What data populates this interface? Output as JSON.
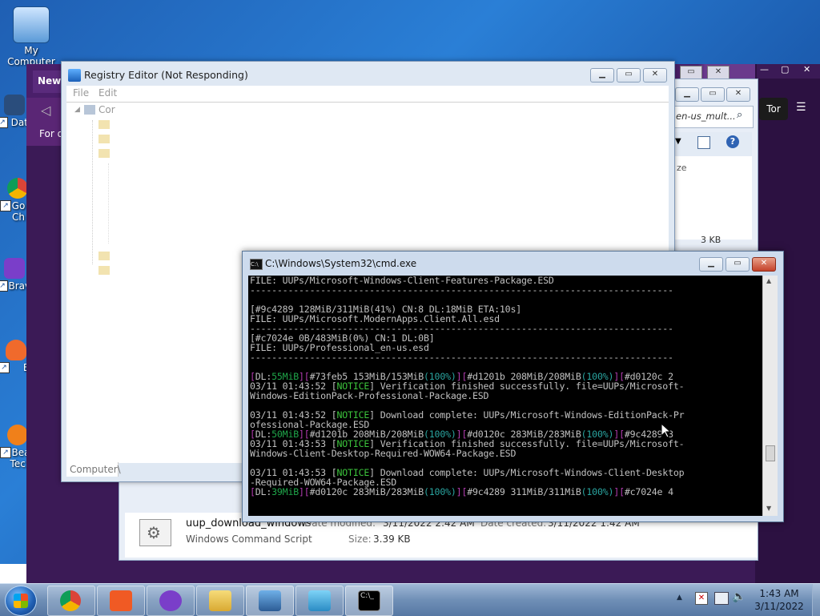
{
  "desktop": {
    "icons": [
      {
        "label": "My Computer"
      },
      {
        "label": "Data"
      },
      {
        "label": "Go Ch"
      },
      {
        "label": "Brave"
      },
      {
        "label": "B"
      },
      {
        "label": "Bea Tech"
      }
    ]
  },
  "browser": {
    "tab_label": "New",
    "subtitle": "For q",
    "tor_button": "Tor"
  },
  "explorer": {
    "search_value": "en-us_mult...",
    "size_column": "ze",
    "size_value": "3 KB",
    "file": {
      "name": "uup_download_windows",
      "type": "Windows Command Script",
      "modified_label": "Date modified:",
      "modified_value": "3/11/2022 2:42 AM",
      "created_label": "Date created:",
      "created_value": "3/11/2022 1:42 AM",
      "size_label": "Size:",
      "size_value": "3.39 KB"
    }
  },
  "registry": {
    "title": "Registry Editor (Not Responding)",
    "menu": [
      "File",
      "Edit"
    ],
    "tree_root": "Cor",
    "status": "Computer\\"
  },
  "cmd": {
    "title": "C:\\Windows\\System32\\cmd.exe",
    "lines": [
      {
        "segs": [
          {
            "t": "FILE: UUPs/Microsoft-Windows-Client-Features-Package.ESD",
            "c": ""
          }
        ]
      },
      {
        "segs": [
          {
            "t": "------------------------------------------------------------------------------",
            "c": ""
          }
        ]
      },
      {
        "segs": [
          {
            "t": "",
            "c": ""
          }
        ]
      },
      {
        "segs": [
          {
            "t": "[#9c4289 128MiB/311MiB(41%) CN:8 DL:18MiB ETA:10s]",
            "c": ""
          }
        ]
      },
      {
        "segs": [
          {
            "t": "FILE: UUPs/Microsoft.ModernApps.Client.All.esd",
            "c": ""
          }
        ]
      },
      {
        "segs": [
          {
            "t": "------------------------------------------------------------------------------",
            "c": ""
          }
        ]
      },
      {
        "segs": [
          {
            "t": "[#c7024e 0B/483MiB(0%) CN:1 DL:0B]",
            "c": ""
          }
        ]
      },
      {
        "segs": [
          {
            "t": "FILE: UUPs/Professional_en-us.esd",
            "c": ""
          }
        ]
      },
      {
        "segs": [
          {
            "t": "------------------------------------------------------------------------------",
            "c": ""
          }
        ]
      },
      {
        "segs": [
          {
            "t": "",
            "c": ""
          }
        ]
      },
      {
        "segs": [
          {
            "t": "[",
            "c": "m"
          },
          {
            "t": "DL:",
            "c": ""
          },
          {
            "t": "55MiB",
            "c": "gg"
          },
          {
            "t": "][",
            "c": "m"
          },
          {
            "t": "#73feb5 153MiB/153MiB",
            "c": ""
          },
          {
            "t": "(100%)",
            "c": "c"
          },
          {
            "t": "][",
            "c": "m"
          },
          {
            "t": "#d1201b 208MiB/208MiB",
            "c": ""
          },
          {
            "t": "(100%)",
            "c": "c"
          },
          {
            "t": "][",
            "c": "m"
          },
          {
            "t": "#d0120c 2",
            "c": ""
          }
        ]
      },
      {
        "segs": [
          {
            "t": "03/11 01:43:52 [",
            "c": ""
          },
          {
            "t": "NOTICE",
            "c": "g"
          },
          {
            "t": "] Verification finished successfully. file=UUPs/Microsoft-",
            "c": ""
          }
        ]
      },
      {
        "segs": [
          {
            "t": "Windows-EditionPack-Professional-Package.ESD",
            "c": ""
          }
        ]
      },
      {
        "segs": [
          {
            "t": "",
            "c": ""
          }
        ]
      },
      {
        "segs": [
          {
            "t": "03/11 01:43:52 [",
            "c": ""
          },
          {
            "t": "NOTICE",
            "c": "g"
          },
          {
            "t": "] Download complete: UUPs/Microsoft-Windows-EditionPack-Pr",
            "c": ""
          }
        ]
      },
      {
        "segs": [
          {
            "t": "ofessional-Package.ESD",
            "c": ""
          }
        ]
      },
      {
        "segs": [
          {
            "t": "[",
            "c": "m"
          },
          {
            "t": "DL:",
            "c": ""
          },
          {
            "t": "50MiB",
            "c": "gg"
          },
          {
            "t": "][",
            "c": "m"
          },
          {
            "t": "#d1201b 208MiB/208MiB",
            "c": ""
          },
          {
            "t": "(100%)",
            "c": "c"
          },
          {
            "t": "][",
            "c": "m"
          },
          {
            "t": "#d0120c 283MiB/283MiB",
            "c": ""
          },
          {
            "t": "(100%)",
            "c": "c"
          },
          {
            "t": "][",
            "c": "m"
          },
          {
            "t": "#9c4289 3",
            "c": ""
          }
        ]
      },
      {
        "segs": [
          {
            "t": "03/11 01:43:53 [",
            "c": ""
          },
          {
            "t": "NOTICE",
            "c": "g"
          },
          {
            "t": "] Verification finished successfully. file=UUPs/Microsoft-",
            "c": ""
          }
        ]
      },
      {
        "segs": [
          {
            "t": "Windows-Client-Desktop-Required-WOW64-Package.ESD",
            "c": ""
          }
        ]
      },
      {
        "segs": [
          {
            "t": "",
            "c": ""
          }
        ]
      },
      {
        "segs": [
          {
            "t": "03/11 01:43:53 [",
            "c": ""
          },
          {
            "t": "NOTICE",
            "c": "g"
          },
          {
            "t": "] Download complete: UUPs/Microsoft-Windows-Client-Desktop",
            "c": ""
          }
        ]
      },
      {
        "segs": [
          {
            "t": "-Required-WOW64-Package.ESD",
            "c": ""
          }
        ]
      },
      {
        "segs": [
          {
            "t": "[",
            "c": "m"
          },
          {
            "t": "DL:",
            "c": ""
          },
          {
            "t": "39MiB",
            "c": "gg"
          },
          {
            "t": "][",
            "c": "m"
          },
          {
            "t": "#d0120c 283MiB/283MiB",
            "c": ""
          },
          {
            "t": "(100%)",
            "c": "c"
          },
          {
            "t": "][",
            "c": "m"
          },
          {
            "t": "#9c4289 311MiB/311MiB",
            "c": ""
          },
          {
            "t": "(100%)",
            "c": "c"
          },
          {
            "t": "][",
            "c": "m"
          },
          {
            "t": "#c7024e 4",
            "c": ""
          }
        ]
      }
    ]
  },
  "taskbar": {
    "apps": [
      "chrome",
      "brave",
      "tor",
      "explorer",
      "regedit",
      "network",
      "cmd"
    ],
    "time": "1:43 AM",
    "date": "3/11/2022"
  }
}
